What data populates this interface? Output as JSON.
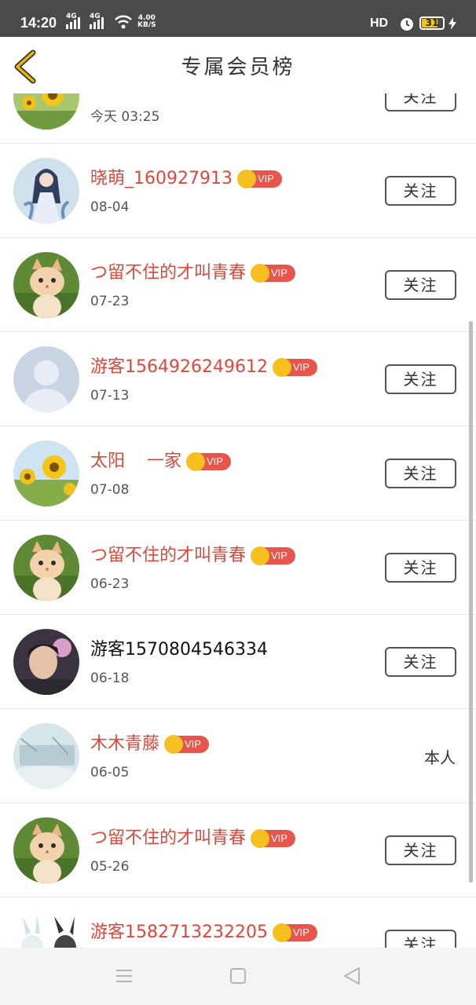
{
  "status_bar": {
    "time": "14:20",
    "net1": "4G",
    "net2": "4G",
    "speed_value": "4.00",
    "speed_unit": "KB/S",
    "hd": "HD",
    "battery": "31"
  },
  "header": {
    "title": "专属会员榜"
  },
  "rows": [
    {
      "name": "",
      "date": "今天 03:25",
      "vip": false,
      "action": "关注",
      "self": false,
      "avatar": "sunflower"
    },
    {
      "name": "晓萌_160927913",
      "date": "08-04",
      "vip": true,
      "action": "关注",
      "self": false,
      "avatar": "anime"
    },
    {
      "name": "つ留不住的才叫青春",
      "date": "07-23",
      "vip": true,
      "action": "关注",
      "self": false,
      "avatar": "kitten"
    },
    {
      "name": "游客1564926249612",
      "date": "07-13",
      "vip": true,
      "action": "关注",
      "self": false,
      "avatar": "default"
    },
    {
      "name": "太阳    一家",
      "date": "07-08",
      "vip": true,
      "action": "关注",
      "self": false,
      "avatar": "sunflower"
    },
    {
      "name": "つ留不住的才叫青春",
      "date": "06-23",
      "vip": true,
      "action": "关注",
      "self": false,
      "avatar": "kitten"
    },
    {
      "name": "游客1570804546334",
      "date": "06-18",
      "vip": false,
      "action": "关注",
      "self": false,
      "avatar": "photo"
    },
    {
      "name": "木木青藤",
      "date": "06-05",
      "vip": true,
      "action": "",
      "self": true,
      "self_label": "本人",
      "avatar": "landscape"
    },
    {
      "name": "つ留不住的才叫青春",
      "date": "05-26",
      "vip": true,
      "action": "关注",
      "self": false,
      "avatar": "kitten"
    },
    {
      "name": "游客1582713232205",
      "date": "",
      "vip": true,
      "action": "关注",
      "self": false,
      "avatar": "bunny"
    }
  ],
  "vip_label": "VIP",
  "colors": {
    "vip_name": "#e0473a",
    "vip_badge": "#e8564b",
    "crown": "#f5c020",
    "back_arrow": "#e8b800"
  }
}
